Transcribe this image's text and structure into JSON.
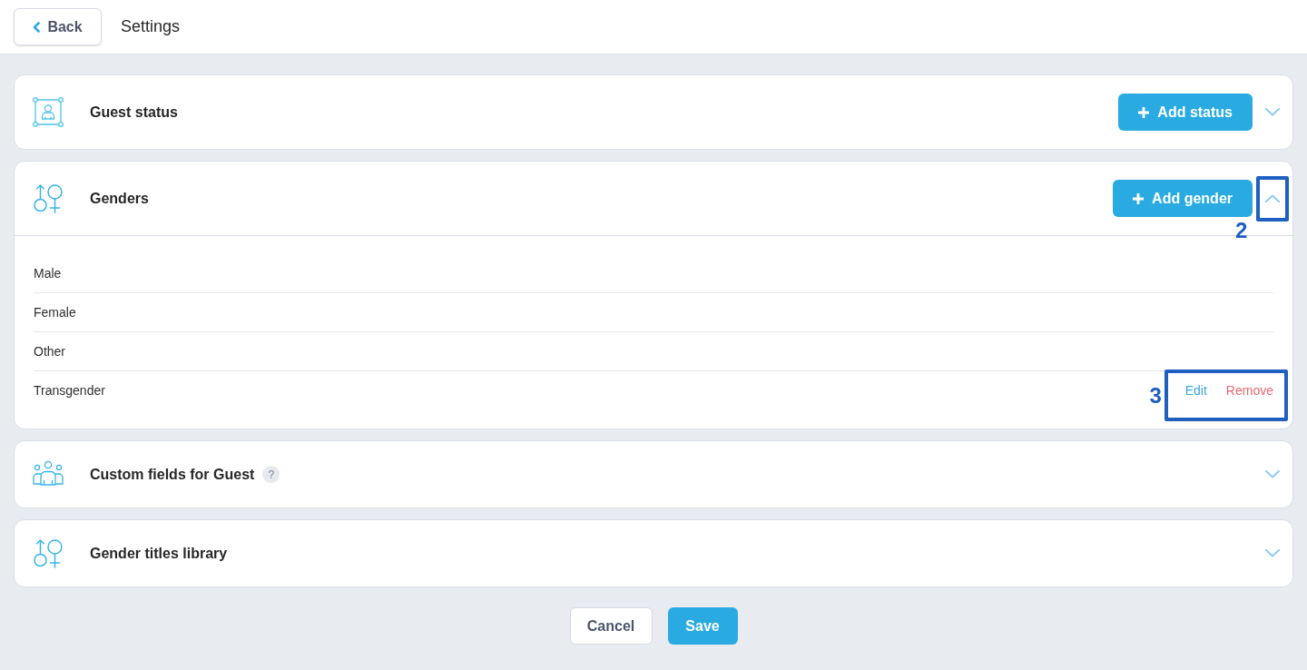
{
  "header": {
    "back_button": "Back",
    "title": "Settings"
  },
  "sections": [
    {
      "title": "Guest status",
      "add_button": "Add status",
      "expanded": false
    },
    {
      "title": "Genders",
      "add_button": "Add gender",
      "expanded": true,
      "toggle_annotation": "2",
      "items": [
        {
          "label": "Male"
        },
        {
          "label": "Female"
        },
        {
          "label": "Other"
        },
        {
          "label": "Transgender",
          "actions": [
            {
              "kind": "edit",
              "label": "Edit"
            },
            {
              "kind": "remove",
              "label": "Remove"
            }
          ],
          "actions_annotation": "3"
        }
      ]
    },
    {
      "title": "Custom fields for Guest",
      "help": "?",
      "expanded": false
    },
    {
      "title": "Gender titles library",
      "expanded": false
    }
  ],
  "footer": {
    "cancel_button": "Cancel",
    "save_button": "Save"
  }
}
